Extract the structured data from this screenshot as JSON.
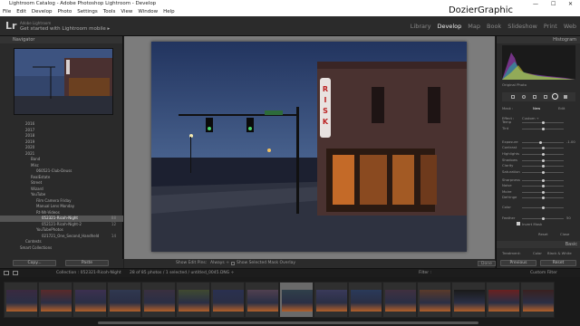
{
  "window": {
    "title": "Lightroom Catalog - Adobe Photoshop Lightroom - Develop",
    "controls": [
      "—",
      "☐",
      "✕"
    ],
    "watermark": "DozierGraphic"
  },
  "menu": [
    "File",
    "Edit",
    "Develop",
    "Photo",
    "Settings",
    "Tools",
    "View",
    "Window",
    "Help"
  ],
  "identity": {
    "logo": "Lr",
    "small": "Adobe Lightroom",
    "main": "Get started with Lightroom mobile ▸",
    "modules": [
      "Library",
      "Develop",
      "Map",
      "Book",
      "Slideshow",
      "Print",
      "Web"
    ],
    "active": "Develop"
  },
  "left": {
    "navigator": "Navigator",
    "folders": [
      {
        "label": "2016",
        "count": ""
      },
      {
        "label": "2017",
        "count": ""
      },
      {
        "label": "2018",
        "count": ""
      },
      {
        "label": "2019",
        "count": ""
      },
      {
        "label": "2020",
        "count": ""
      },
      {
        "label": "2021",
        "count": ""
      },
      {
        "label": "Band",
        "count": ""
      },
      {
        "label": "Misc",
        "count": ""
      },
      {
        "label": "060521-Club-Deuss",
        "count": ""
      },
      {
        "label": "RealEstate",
        "count": ""
      },
      {
        "label": "Street",
        "count": ""
      },
      {
        "label": "Wizard",
        "count": ""
      },
      {
        "label": "YouTube",
        "count": ""
      },
      {
        "label": "Film Camera Friday",
        "count": ""
      },
      {
        "label": "Manual Lens Monday",
        "count": ""
      },
      {
        "label": "Rt-Nh-Videos",
        "count": ""
      },
      {
        "label": "052321-Ricoh-Night",
        "count": "88"
      },
      {
        "label": "052121-Ricoh-Night-2",
        "count": "12"
      },
      {
        "label": "YouTubePhotos",
        "count": ""
      },
      {
        "label": "021721_One_Second_Handheld",
        "count": "14"
      },
      {
        "label": "Contests",
        "count": ""
      },
      {
        "label": "Smart Collections",
        "count": ""
      }
    ],
    "selected_index": 16,
    "import_label": "Copy...",
    "export_label": "Paste"
  },
  "toolbar": {
    "show_edit_pins": "Show Edit Pins:",
    "pins_value": "Always ÷",
    "show_overlay": "Show Selected Mask Overlay",
    "done": "Done"
  },
  "right": {
    "histogram": "Histogram",
    "original": "Original Photo",
    "mask": "Mask :",
    "new": "New",
    "edit": "Edit",
    "effect": "Effect :",
    "custom": "Custom ÷",
    "rows": [
      {
        "label": "Temp",
        "value": ""
      },
      {
        "label": "Tint",
        "value": ""
      },
      {
        "label": "Exposure",
        "value": "-1.00"
      },
      {
        "label": "Contrast",
        "value": ""
      },
      {
        "label": "Highlights",
        "value": ""
      },
      {
        "label": "Shadows",
        "value": ""
      },
      {
        "label": "Clarity",
        "value": ""
      },
      {
        "label": "Saturation",
        "value": ""
      },
      {
        "label": "Sharpness",
        "value": ""
      },
      {
        "label": "Noise",
        "value": ""
      },
      {
        "label": "Moire",
        "value": ""
      },
      {
        "label": "Defringe",
        "value": ""
      },
      {
        "label": "Color",
        "value": ""
      },
      {
        "label": "Feather",
        "value": "50"
      }
    ],
    "invert": "Invert Mask",
    "reset": "Reset",
    "close": "Close",
    "basic": "Basic",
    "treatment": "Treatment:",
    "color": "Color",
    "bw": "Black & White",
    "previous": "Previous",
    "reset_btn": "Reset"
  },
  "filmbar": {
    "collection": "Collection : 052321-Ricoh-Night",
    "info": "28 of 85 photos / 1 selected / untitled_0045.DNG ÷",
    "filter": "Filter :",
    "filter_value": "Custom Filter"
  },
  "colors": {
    "accent": "#cccccc",
    "panel": "#2a2a2a",
    "photo_sky": "#3a4e78"
  }
}
